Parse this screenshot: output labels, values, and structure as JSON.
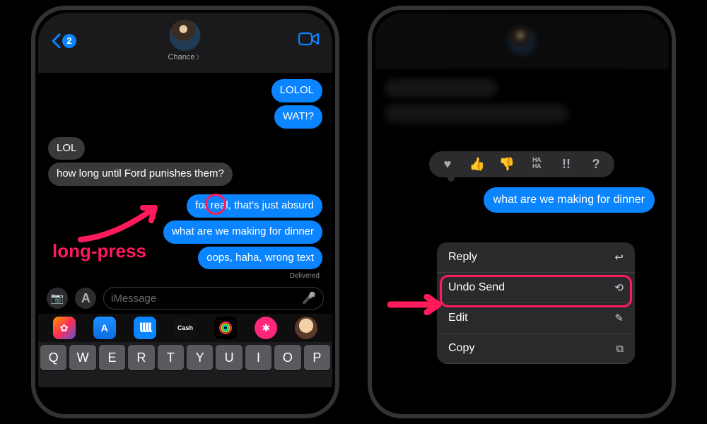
{
  "left": {
    "back_count": "2",
    "contact_name": "Chance",
    "messages": {
      "sent1": "LOLOL",
      "sent2": "WAT!?",
      "recv1": "LOL",
      "recv2": "how long until Ford punishes them?",
      "sent3": "for real, that's just absurd",
      "sent4": "what are we making for dinner",
      "sent5": "oops, haha, wrong text"
    },
    "delivered_label": "Delivered",
    "input_placeholder": "iMessage",
    "apps": {
      "cash_label": "Cash"
    },
    "keyboard_row1": [
      "Q",
      "W",
      "E",
      "R",
      "T",
      "Y",
      "U",
      "I",
      "O",
      "P"
    ],
    "annotation_label": "long-press"
  },
  "right": {
    "tapbacks": {
      "heart": "♥",
      "thumbs_up": "👍",
      "thumbs_down": "👎",
      "haha": "HA HA",
      "emphasis": "!!",
      "question": "?"
    },
    "focused_message": "what are we making for dinner",
    "menu": {
      "reply": "Reply",
      "undo_send": "Undo Send",
      "edit": "Edit",
      "copy": "Copy"
    }
  }
}
